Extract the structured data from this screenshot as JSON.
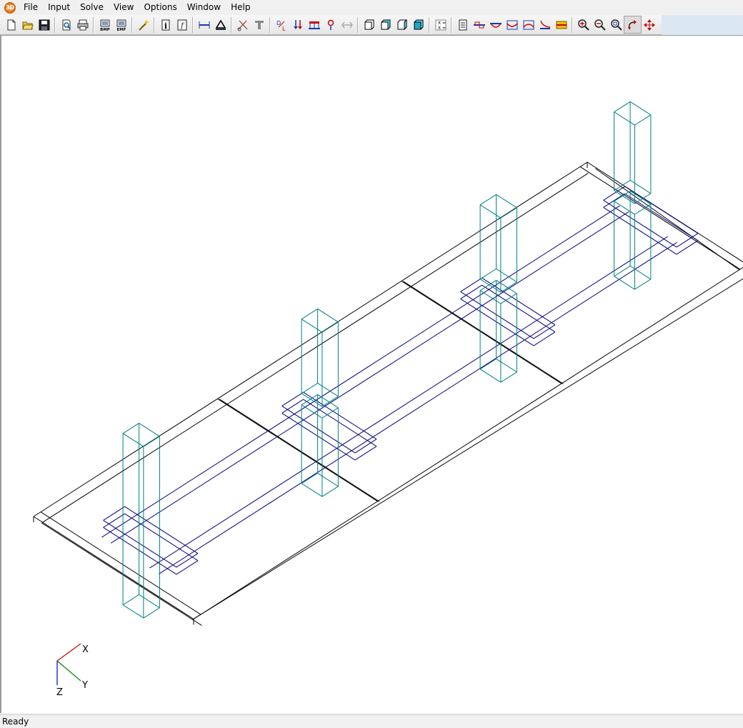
{
  "app": {
    "icon": "3d-app-icon",
    "icon_glyph": "3D"
  },
  "menu": [
    "File",
    "Input",
    "Solve",
    "View",
    "Options",
    "Window",
    "Help"
  ],
  "toolbar": [
    {
      "name": "new-document-icon"
    },
    {
      "name": "open-folder-icon"
    },
    {
      "name": "save-disk-icon"
    },
    {
      "sep": true
    },
    {
      "name": "print-preview-icon"
    },
    {
      "name": "print-icon"
    },
    {
      "sep": true
    },
    {
      "name": "export-bmp-icon",
      "text": "BMP"
    },
    {
      "name": "export-emf-icon",
      "text": "EMF"
    },
    {
      "sep": true
    },
    {
      "name": "magic-wand-icon"
    },
    {
      "sep": true
    },
    {
      "name": "info-icon"
    },
    {
      "name": "formula-icon"
    },
    {
      "sep": true
    },
    {
      "name": "dimension-icon"
    },
    {
      "name": "support-triangle-icon"
    },
    {
      "sep": true
    },
    {
      "name": "scissors-icon"
    },
    {
      "name": "section-tee-icon"
    },
    {
      "sep": true
    },
    {
      "name": "dead-live-load-icon"
    },
    {
      "name": "point-load-icon"
    },
    {
      "name": "distributed-load-icon"
    },
    {
      "name": "moment-load-icon"
    },
    {
      "name": "displacement-icon"
    },
    {
      "sep": true
    },
    {
      "name": "view-box-front-icon"
    },
    {
      "name": "view-box-side-icon"
    },
    {
      "name": "view-box-top-icon"
    },
    {
      "name": "view-box-iso-icon"
    },
    {
      "sep": true
    },
    {
      "name": "calculator-icon"
    },
    {
      "sep": true
    },
    {
      "name": "report-icon"
    },
    {
      "name": "shear-diagram-icon"
    },
    {
      "name": "moment-diagram-icon"
    },
    {
      "name": "deflection-diagram-icon"
    },
    {
      "name": "stress-diagram-icon"
    },
    {
      "name": "axial-diagram-icon"
    },
    {
      "name": "envelope-icon"
    },
    {
      "sep": true
    },
    {
      "name": "zoom-in-icon"
    },
    {
      "name": "zoom-out-icon"
    },
    {
      "name": "zoom-fit-icon"
    },
    {
      "name": "rotate-icon",
      "pressed": true
    },
    {
      "name": "pan-icon"
    }
  ],
  "axes": {
    "x": "X",
    "y": "Y",
    "z": "Z",
    "x_color": "#cc0000",
    "y_color": "#008800",
    "z_color": "#0000cc"
  },
  "colors": {
    "slab": "#000000",
    "beam": "#000080",
    "column": "#008080"
  },
  "status": "Ready"
}
